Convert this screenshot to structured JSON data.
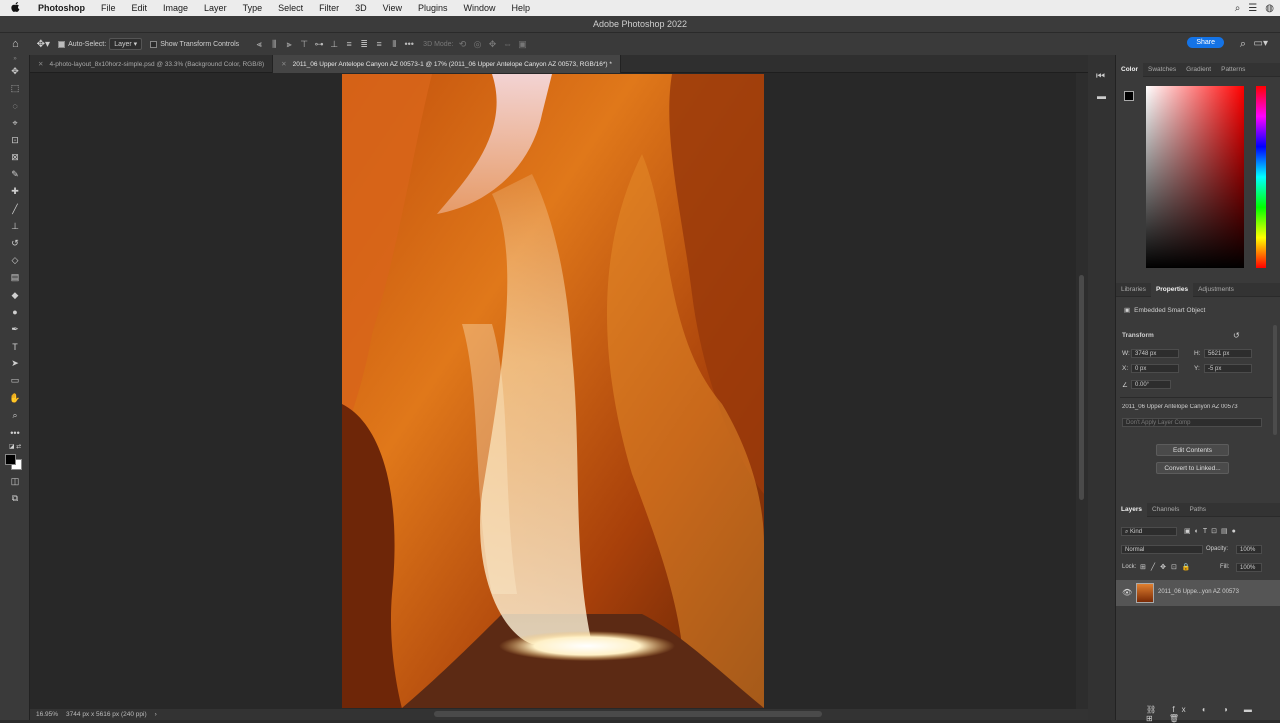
{
  "menubar": {
    "apple": "",
    "items": [
      "Photoshop",
      "File",
      "Edit",
      "Image",
      "Layer",
      "Type",
      "Select",
      "Filter",
      "3D",
      "View",
      "Plugins",
      "Window",
      "Help"
    ]
  },
  "window": {
    "title": "Adobe Photoshop 2022"
  },
  "options": {
    "auto_select_label": "Auto-Select:",
    "auto_select_value": "Layer",
    "transform_label": "Show Transform Controls",
    "mode_label": "3D Mode:",
    "share_label": "Share"
  },
  "tabs": [
    {
      "label": "4-photo-layout_8x10horz-simple.psd @ 33.3% (Background Color, RGB/8)"
    },
    {
      "label": "2011_06 Upper Antelope Canyon AZ 00573-1 @ 17% (2011_06 Upper Antelope Canyon AZ 00573, RGB/16*) *"
    }
  ],
  "status": {
    "zoom": "16.95%",
    "dimensions": "3744 px x 5616 px (240 ppi)"
  },
  "color_panel": {
    "tabs": [
      "Color",
      "Swatches",
      "Gradient",
      "Patterns"
    ],
    "active": "Color"
  },
  "properties_panel": {
    "tabs": [
      "Libraries",
      "Properties",
      "Adjustments"
    ],
    "active": "Properties",
    "type": "Embedded Smart Object",
    "section": "Transform",
    "w_label": "W:",
    "w_value": "3748 px",
    "h_label": "H:",
    "h_value": "5621 px",
    "x_label": "X:",
    "x_value": "0 px",
    "y_label": "Y:",
    "y_value": "-5 px",
    "angle_value": "0.00°",
    "filename": "2011_06 Upper Antelope Canyon AZ 00573",
    "layer_comp": "Don't Apply Layer Comp",
    "edit_contents": "Edit Contents",
    "convert_linked": "Convert to Linked..."
  },
  "layers_panel": {
    "tabs": [
      "Layers",
      "Channels",
      "Paths"
    ],
    "active": "Layers",
    "filter": "Kind",
    "blend_mode": "Normal",
    "opacity_label": "Opacity:",
    "opacity_value": "100%",
    "lock_label": "Lock:",
    "fill_label": "Fill:",
    "fill_value": "100%",
    "layer_name": "2011_06 Uppe...yon AZ 00573"
  },
  "colors": {
    "accent": "#1473e6",
    "foreground": "#000000",
    "background": "#ffffff"
  }
}
